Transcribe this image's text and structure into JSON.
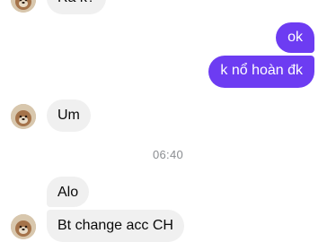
{
  "conversation": {
    "messages": [
      {
        "id": "m0",
        "direction": "incoming",
        "text": "Ra k?"
      },
      {
        "id": "m1",
        "direction": "outgoing",
        "text": "ok"
      },
      {
        "id": "m2",
        "direction": "outgoing",
        "text": "k nổ hoàn đk"
      },
      {
        "id": "m3",
        "direction": "incoming",
        "text": "Um"
      },
      {
        "id": "m4",
        "direction": "incoming",
        "text": "Alo"
      },
      {
        "id": "m5",
        "direction": "incoming",
        "text": "Bt change acc CH"
      }
    ],
    "timestamp": "06:40"
  },
  "colors": {
    "outgoing_bubble": "#6d3cf2",
    "incoming_bubble": "#f0f0f0",
    "timestamp_text": "#8a8d91"
  },
  "icons": {
    "contact_avatar": "dog-photo-avatar"
  }
}
